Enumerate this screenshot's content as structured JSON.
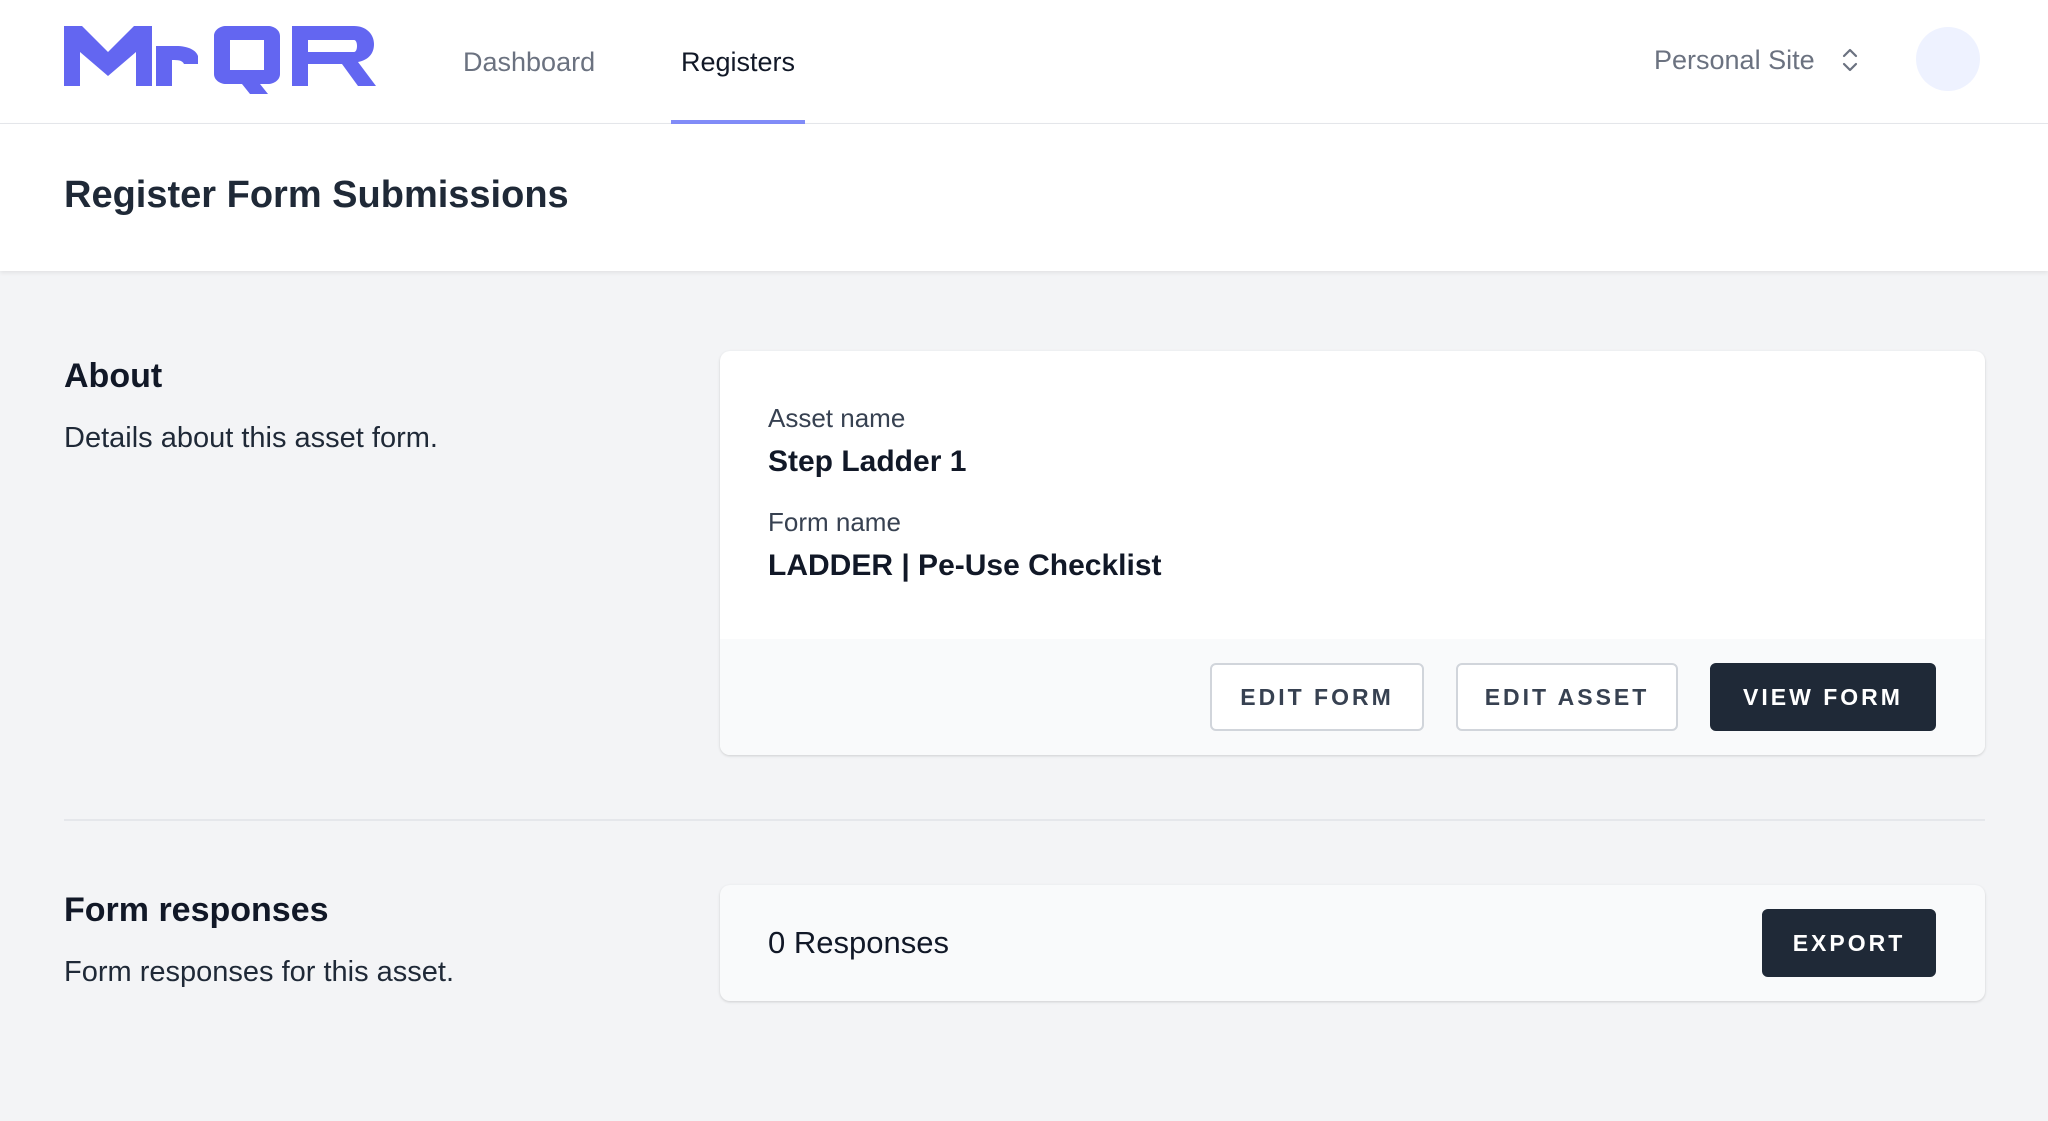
{
  "brand": {
    "logo_text": "MrQR",
    "logo_color": "#6366f1"
  },
  "nav": {
    "items": [
      {
        "label": "Dashboard",
        "active": false
      },
      {
        "label": "Registers",
        "active": true
      }
    ],
    "active_indicator_color": "#818cf8"
  },
  "site_switcher": {
    "label": "Personal Site",
    "icon": "chevron-up-down-icon"
  },
  "user": {
    "avatar_icon": "avatar"
  },
  "page": {
    "title": "Register Form Submissions"
  },
  "about": {
    "title": "About",
    "description": "Details about this asset form.",
    "asset_name_label": "Asset name",
    "asset_name": "Step Ladder 1",
    "form_name_label": "Form name",
    "form_name": "LADDER | Pe-Use Checklist",
    "buttons": {
      "edit_form": "EDIT FORM",
      "edit_asset": "EDIT ASSET",
      "view_form": "VIEW FORM"
    }
  },
  "responses": {
    "title": "Form responses",
    "description": "Form responses for this asset.",
    "count_text": "0 Responses",
    "export_label": "EXPORT"
  },
  "colors": {
    "primary_dark": "#1f2937",
    "page_background": "#f3f4f6"
  }
}
